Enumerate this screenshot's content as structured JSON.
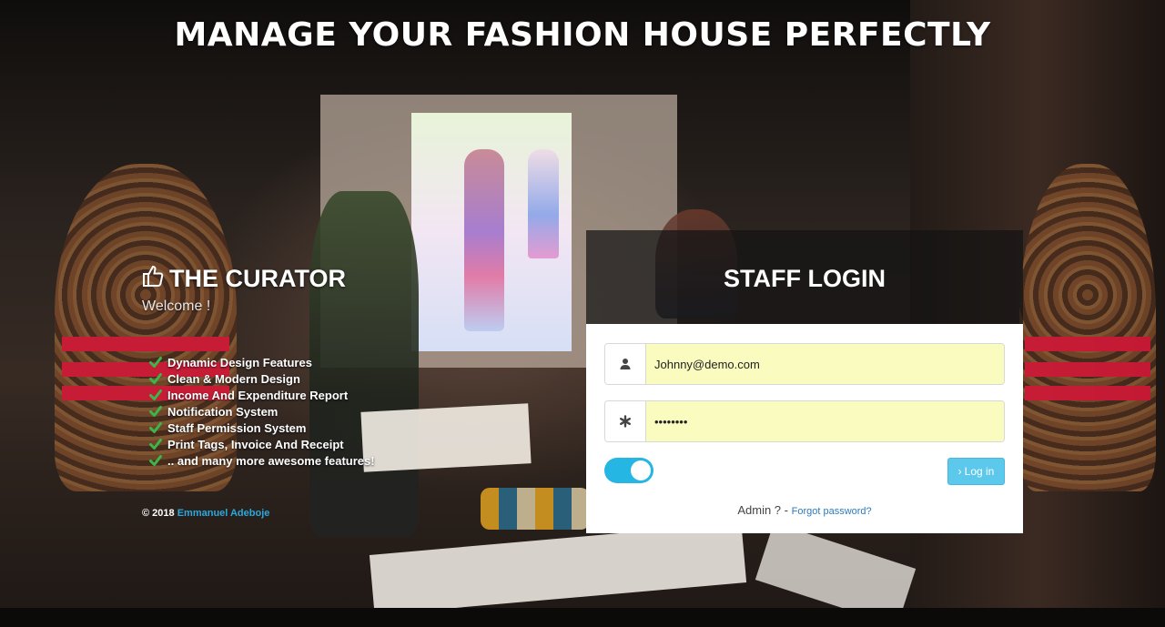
{
  "page": {
    "headline": "MANAGE YOUR FASHION HOUSE PERFECTLY"
  },
  "brand": {
    "name": "THE CURATOR",
    "icon": "thumbs-up-icon",
    "welcome": "Welcome !"
  },
  "features": [
    "Dynamic Design Features",
    "Clean & Modern Design",
    "Income And Expenditure Report",
    "Notification System",
    "Staff Permission System",
    "Print Tags, Invoice And Receipt",
    ".. and many more awesome features!"
  ],
  "footer": {
    "copyright_prefix": "© 2018",
    "author": "Emmanuel Adeboje"
  },
  "login": {
    "title": "STAFF LOGIN",
    "email_value": "Johnny@demo.com",
    "password_value": "••••••••",
    "toggle_on": true,
    "login_button_label": "Log in",
    "admin_prompt": "Admin ? -",
    "forgot_link": "Forgot password?"
  },
  "colors": {
    "accent": "#25b6e3",
    "button": "#5cc8ec",
    "input_fill": "#fafcbf",
    "check": "#3cb54a",
    "link": "#2b7bbf"
  }
}
